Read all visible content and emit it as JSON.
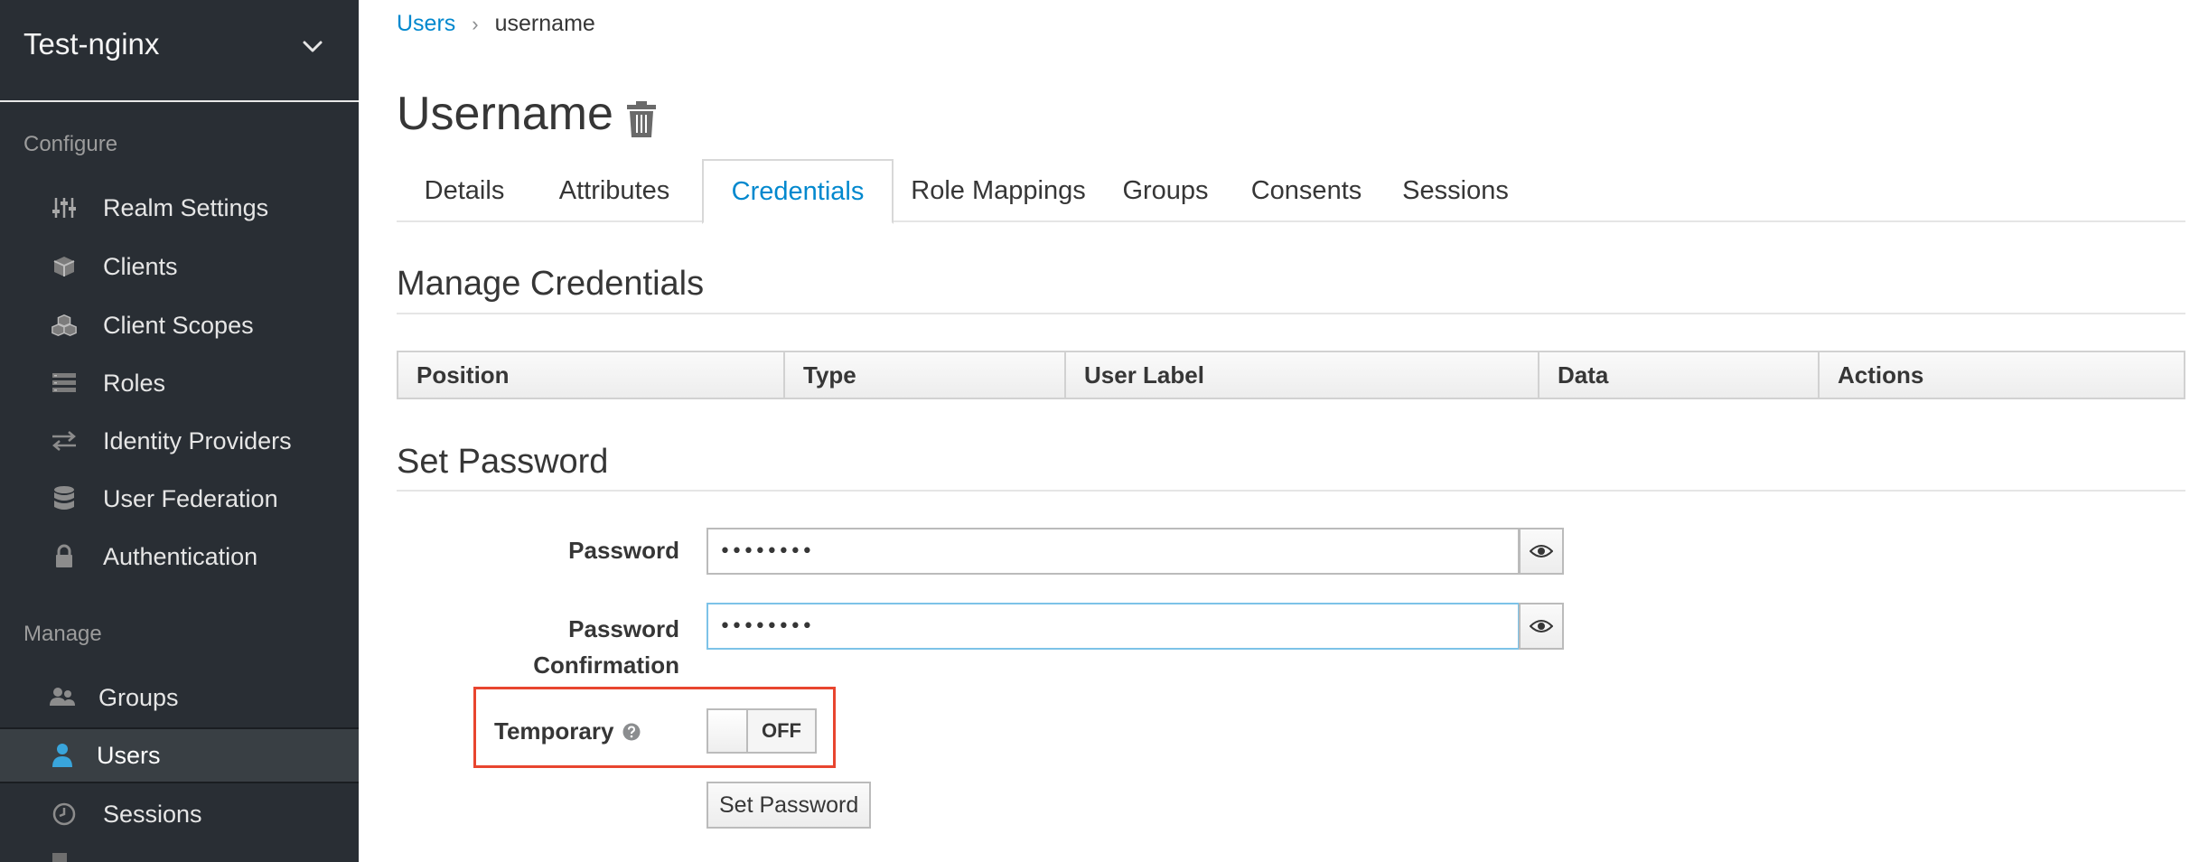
{
  "sidebar": {
    "realm": {
      "name": "Test-nginx",
      "icon": "chevron-down-icon"
    },
    "configure_label": "Configure",
    "configure_items": [
      {
        "label": "Realm Settings",
        "icon": "sliders-icon"
      },
      {
        "label": "Clients",
        "icon": "cube-icon"
      },
      {
        "label": "Client Scopes",
        "icon": "cubes-icon"
      },
      {
        "label": "Roles",
        "icon": "list-icon"
      },
      {
        "label": "Identity Providers",
        "icon": "exchange-icon"
      },
      {
        "label": "User Federation",
        "icon": "database-icon"
      },
      {
        "label": "Authentication",
        "icon": "lock-icon"
      }
    ],
    "manage_label": "Manage",
    "manage_items": [
      {
        "label": "Groups",
        "icon": "users-icon"
      },
      {
        "label": "Users",
        "icon": "user-icon",
        "active": true
      },
      {
        "label": "Sessions",
        "icon": "clock-icon"
      }
    ]
  },
  "breadcrumb": {
    "parent": "Users",
    "separator": "›",
    "current": "username"
  },
  "page": {
    "title": "Username"
  },
  "tabs": [
    {
      "label": "Details"
    },
    {
      "label": "Attributes"
    },
    {
      "label": "Credentials",
      "active": true
    },
    {
      "label": "Role Mappings"
    },
    {
      "label": "Groups"
    },
    {
      "label": "Consents"
    },
    {
      "label": "Sessions"
    }
  ],
  "manage_credentials": {
    "title": "Manage Credentials",
    "columns": [
      "Position",
      "Type",
      "User Label",
      "Data",
      "Actions"
    ]
  },
  "set_password": {
    "title": "Set Password",
    "password_label": "Password",
    "password_value": "••••••••",
    "confirmation_label_line1": "Password",
    "confirmation_label_line2": "Confirmation",
    "confirmation_value": "••••••••",
    "temporary_label": "Temporary",
    "temporary_state": "OFF",
    "submit_label": "Set Password"
  },
  "colors": {
    "sidebar_bg": "#292e34",
    "link": "#0088ce",
    "active_user_icon": "#39a5dc",
    "highlight_box": "#e8452f"
  }
}
